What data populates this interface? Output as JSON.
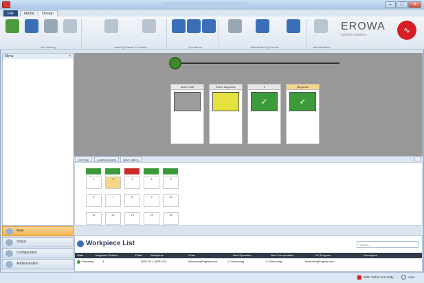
{
  "window": {
    "title": "",
    "menu_tabs": [
      "File",
      "Home",
      "Design"
    ]
  },
  "ribbon": {
    "group_labels": [
      "Job Loading",
      "Loading/Transfer Functions",
      "Operations",
      "Manufacturing Process",
      "Administration"
    ],
    "colors": {
      "blue": "#3a6fb8",
      "green": "#4f9a3d",
      "gray": "#9aa8b6"
    }
  },
  "logo": {
    "brand": "EROWA",
    "sub": "system solutions"
  },
  "left": {
    "header": "Menu",
    "nav": [
      "Main",
      "Status",
      "Configuration",
      "Administration"
    ]
  },
  "machine": {
    "slots": [
      {
        "label": "Base EMM",
        "state": "gray"
      },
      {
        "label": "Robot Magazine",
        "state": "yellow"
      },
      {
        "label": "1",
        "state": "green"
      },
      {
        "label": "Magazine",
        "state": "green",
        "header_color": "#f5d58a"
      }
    ],
    "check_symbol": "✓"
  },
  "tabs": [
    "Overview",
    "Loading spaces",
    "Base Station"
  ],
  "magazine": {
    "row1": [
      "1",
      "2",
      "3",
      "4",
      "5"
    ],
    "row2": [
      "6",
      "7",
      "8",
      "9",
      "10"
    ],
    "row3": [
      "11",
      "12",
      "13",
      "14",
      "15"
    ]
  },
  "workpiece": {
    "title": "Workpiece List",
    "search_placeholder": "Search...",
    "columns": [
      "State",
      "Magazine Position",
      "Pallet",
      "Workpiece",
      "Order",
      "Next Operation",
      "Next Job operation",
      "NC Program",
      "Description"
    ],
    "row": {
      "state": "Preparing",
      "pos": "3",
      "pallet": "",
      "workpiece": "WPD-001 / WPD-001",
      "order": "MeasuringProgram.mcc",
      "nextop": "1 / Measuring",
      "nextjob": "1 / Measuring",
      "nc": "MeasuringProgram.mcc",
      "desc": ""
    }
  },
  "status": {
    "text": "JMS: Robot not ready",
    "mode": "Auto"
  }
}
